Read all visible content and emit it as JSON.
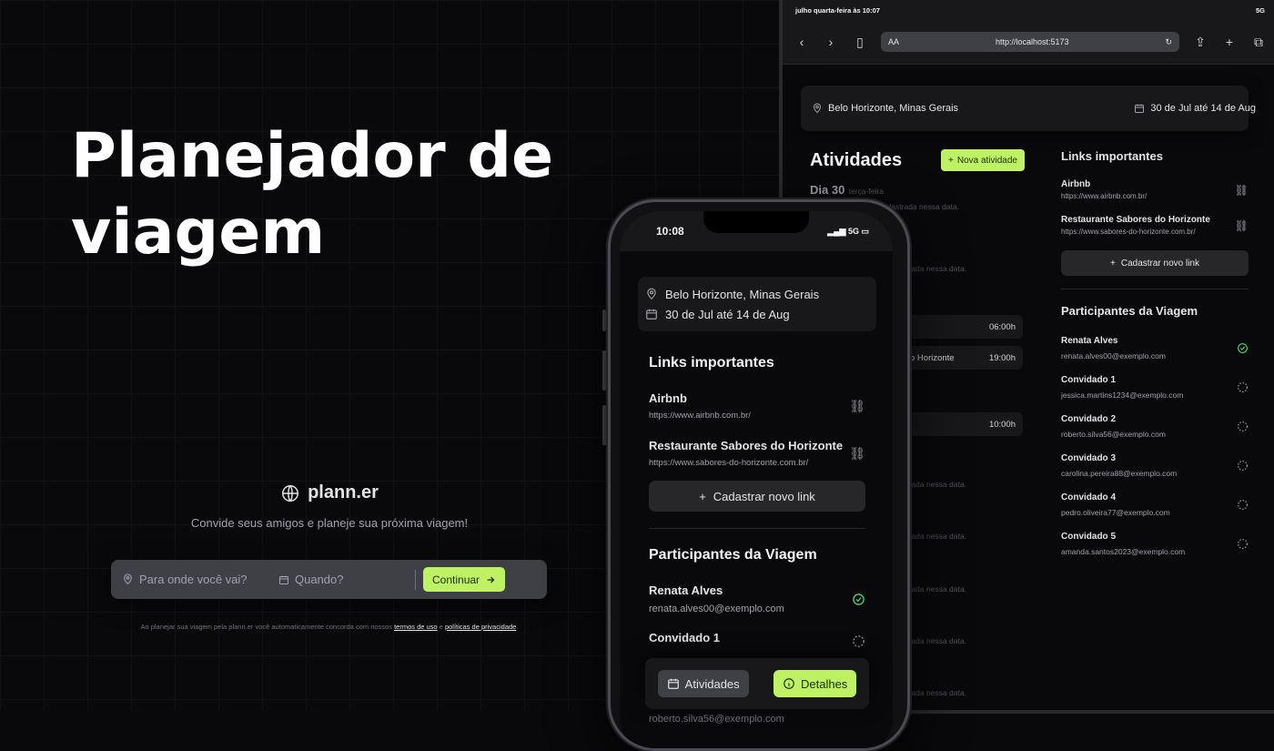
{
  "hero": {
    "line1": "Planejador de",
    "line2": "viagem"
  },
  "landing": {
    "brand": "plann.er",
    "tagline": "Convide seus amigos e planeje sua próxima viagem!",
    "destination_placeholder": "Para onde você vai?",
    "when_placeholder": "Quando?",
    "continue_label": "Continuar",
    "terms_prefix": "Ao planejar sua viagem pela plann.er você automaticamente concorda com nossos",
    "terms_link": "termos de uso",
    "terms_and": "e",
    "privacy_link": "políticas de privacidade",
    "terms_suffix": "."
  },
  "tablet": {
    "status_time": "julho quarta-feira às 10:07",
    "status_right": "5G",
    "url_size": "AA",
    "url": "http://localhost:5173",
    "location": "Belo Horizonte, Minas Gerais",
    "dates": "30 de Jul até 14 de Aug",
    "activities_title": "Atividades",
    "new_activity": "Nova atividade",
    "day_label": "Dia 30",
    "day_weekday": "terça-feira",
    "empty_text": "Nenhuma atividade cadastrada nessa data.",
    "empty_frag1": "cadastrada nessa data.",
    "empty_frag2": "strada nessa data.",
    "row_times": [
      "06:00h",
      "19:00h",
      "10:00h"
    ],
    "row_frag": "o Horizonte",
    "links_title": "Links importantes",
    "links": [
      {
        "name": "Airbnb",
        "url": "https://www.airbnb.com.br/"
      },
      {
        "name": "Restaurante Sabores do Horizonte",
        "url": "https://www.sabores-do-horizonte.com.br/"
      }
    ],
    "add_link": "Cadastrar novo link",
    "participants_title": "Participantes da Viagem",
    "participants": [
      {
        "name": "Renata Alves",
        "email": "renata.alves00@exemplo.com",
        "confirmed": true
      },
      {
        "name": "Convidado 1",
        "email": "jessica.martins1234@exemplo.com",
        "confirmed": false
      },
      {
        "name": "Convidado 2",
        "email": "roberto.silva56@exemplo.com",
        "confirmed": false
      },
      {
        "name": "Convidado 3",
        "email": "carolina.pereira88@exemplo.com",
        "confirmed": false
      },
      {
        "name": "Convidado 4",
        "email": "pedro.oliveira77@exemplo.com",
        "confirmed": false
      },
      {
        "name": "Convidado 5",
        "email": "amanda.santos2023@exemplo.com",
        "confirmed": false
      }
    ]
  },
  "phone": {
    "time": "10:08",
    "network": "5G",
    "location": "Belo Horizonte, Minas Gerais",
    "dates": "30 de Jul até 14 de Aug",
    "links_title": "Links importantes",
    "links": [
      {
        "name": "Airbnb",
        "url": "https://www.airbnb.com.br/"
      },
      {
        "name": "Restaurante Sabores do Horizonte",
        "url": "https://www.sabores-do-horizonte.com.br/"
      }
    ],
    "add_link": "Cadastrar novo link",
    "participants_title": "Participantes da Viagem",
    "participants": [
      {
        "name": "Renata Alves",
        "email": "renata.alves00@exemplo.com"
      },
      {
        "name": "Convidado 1",
        "email": ""
      }
    ],
    "peek_email": "roberto.silva56@exemplo.com",
    "tab_activities": "Atividades",
    "tab_details": "Detalhes"
  },
  "colors": {
    "accent": "#bef264",
    "bg": "#09090b",
    "surface": "#18181b",
    "confirmed": "#4ade80"
  }
}
